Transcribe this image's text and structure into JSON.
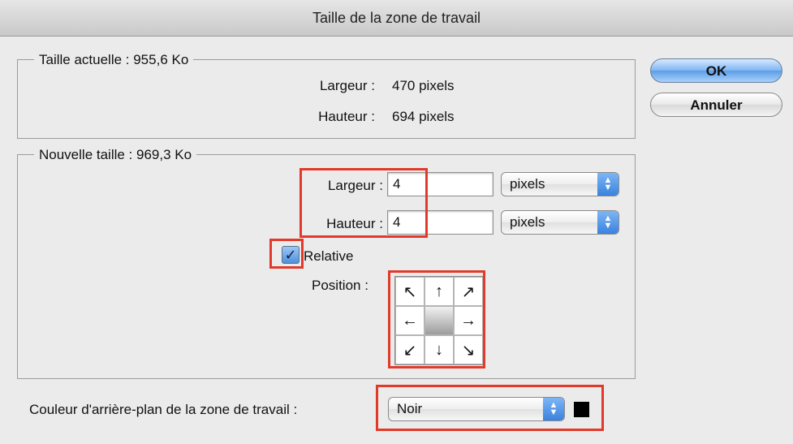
{
  "window": {
    "title": "Taille de la zone de travail"
  },
  "current_size": {
    "legend": "Taille actuelle : 955,6 Ko",
    "width_label": "Largeur :",
    "width_value": "470 pixels",
    "height_label": "Hauteur :",
    "height_value": "694 pixels"
  },
  "new_size": {
    "legend": "Nouvelle taille : 969,3 Ko",
    "width_label": "Largeur :",
    "width_value": "4",
    "width_unit": "pixels",
    "height_label": "Hauteur :",
    "height_value": "4",
    "height_unit": "pixels",
    "relative_label": "Relative",
    "relative_checked": true,
    "position_label": "Position :",
    "anchor_arrows": [
      "↖",
      "↑",
      "↗",
      "←",
      "",
      "→",
      "↙",
      "↓",
      "↘"
    ]
  },
  "buttons": {
    "ok": "OK",
    "cancel": "Annuler"
  },
  "background": {
    "label": "Couleur d'arrière-plan de la zone de travail :",
    "value": "Noir",
    "swatch_color": "#000000"
  },
  "colors": {
    "highlight": "#e23a2a",
    "accent": "#5c9ee8"
  }
}
